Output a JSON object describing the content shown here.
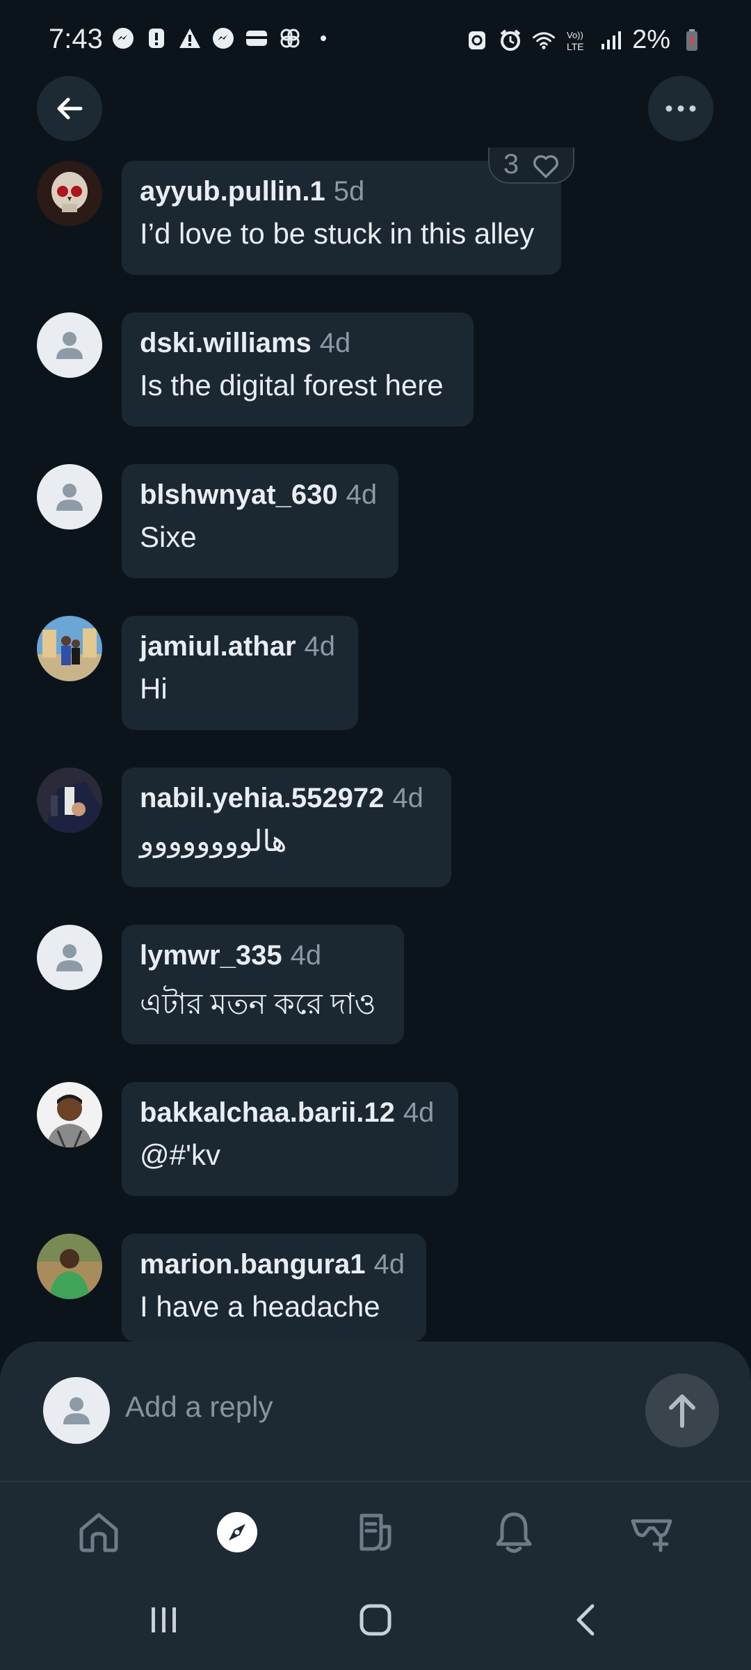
{
  "status_bar": {
    "time": "7:43",
    "battery": "2%",
    "left_icons": [
      "messenger-icon",
      "alert-icon",
      "warning-icon",
      "messenger-icon",
      "wallet-icon",
      "pinwheel-icon",
      "dot-icon"
    ],
    "right_icons": [
      "recycle-icon",
      "alarm-icon",
      "wifi-icon",
      "volte-icon",
      "signal-icon",
      "battery-icon"
    ]
  },
  "header": {
    "back_icon": "arrow-left-icon",
    "more_icon": "more-horizontal-icon"
  },
  "comments": [
    {
      "username": "ayyub.pullin.1",
      "time": "5d",
      "text": "I’d love to be stuck in this alley",
      "avatar": "skull-photo"
    },
    {
      "username": "dski.williams",
      "time": "4d",
      "text": "Is the digital forest here",
      "avatar": "default"
    },
    {
      "username": "blshwnyat_630",
      "time": "4d",
      "text": "Sixe",
      "avatar": "default"
    },
    {
      "username": "jamiul.athar",
      "time": "4d",
      "text": "Hi",
      "avatar": "photo"
    },
    {
      "username": "nabil.yehia.552972",
      "time": "4d",
      "text": "هالوووووووو",
      "avatar": "photo"
    },
    {
      "username": "lymwr_335",
      "time": "4d",
      "text": "এটার মতন করে দাও",
      "avatar": "default"
    },
    {
      "username": "bakkalchaa.barii.12",
      "time": "4d",
      "text": "@#'kv",
      "avatar": "photo"
    },
    {
      "username": "marion.bangura1",
      "time": "4d",
      "text": "I have a headache",
      "avatar": "photo"
    }
  ],
  "likes": {
    "count": "3"
  },
  "reply": {
    "placeholder": "Add a reply"
  },
  "bottom_nav": [
    "home",
    "explore",
    "feed",
    "notifications",
    "glasses-plus"
  ],
  "colors": {
    "background": "#0c141b",
    "bubble": "#1b2731",
    "panel": "#1d2933",
    "muted": "#8b98a5"
  }
}
